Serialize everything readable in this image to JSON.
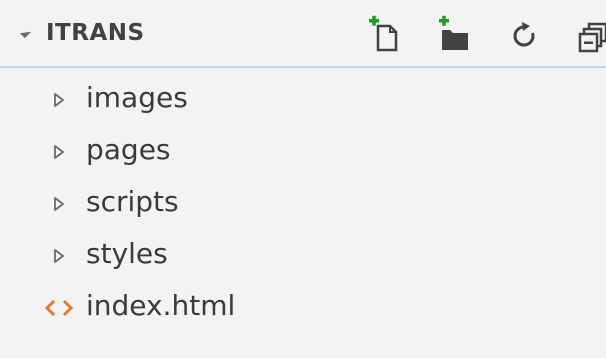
{
  "explorer": {
    "title": "ITRANS",
    "actions": [
      {
        "name": "new-file-icon"
      },
      {
        "name": "new-folder-icon"
      },
      {
        "name": "refresh-icon"
      },
      {
        "name": "collapse-all-icon"
      }
    ],
    "items": [
      {
        "label": "images",
        "type": "folder",
        "icon": "chevron-right-icon"
      },
      {
        "label": "pages",
        "type": "folder",
        "icon": "chevron-right-icon"
      },
      {
        "label": "scripts",
        "type": "folder",
        "icon": "chevron-right-icon"
      },
      {
        "label": "styles",
        "type": "folder",
        "icon": "chevron-right-icon"
      },
      {
        "label": "index.html",
        "type": "file",
        "icon": "html-file-icon"
      }
    ]
  },
  "colors": {
    "accent_green": "#1e9e1e",
    "icon_gray": "#424242",
    "html_orange": "#e37933",
    "header_border": "#b9d7f0"
  }
}
